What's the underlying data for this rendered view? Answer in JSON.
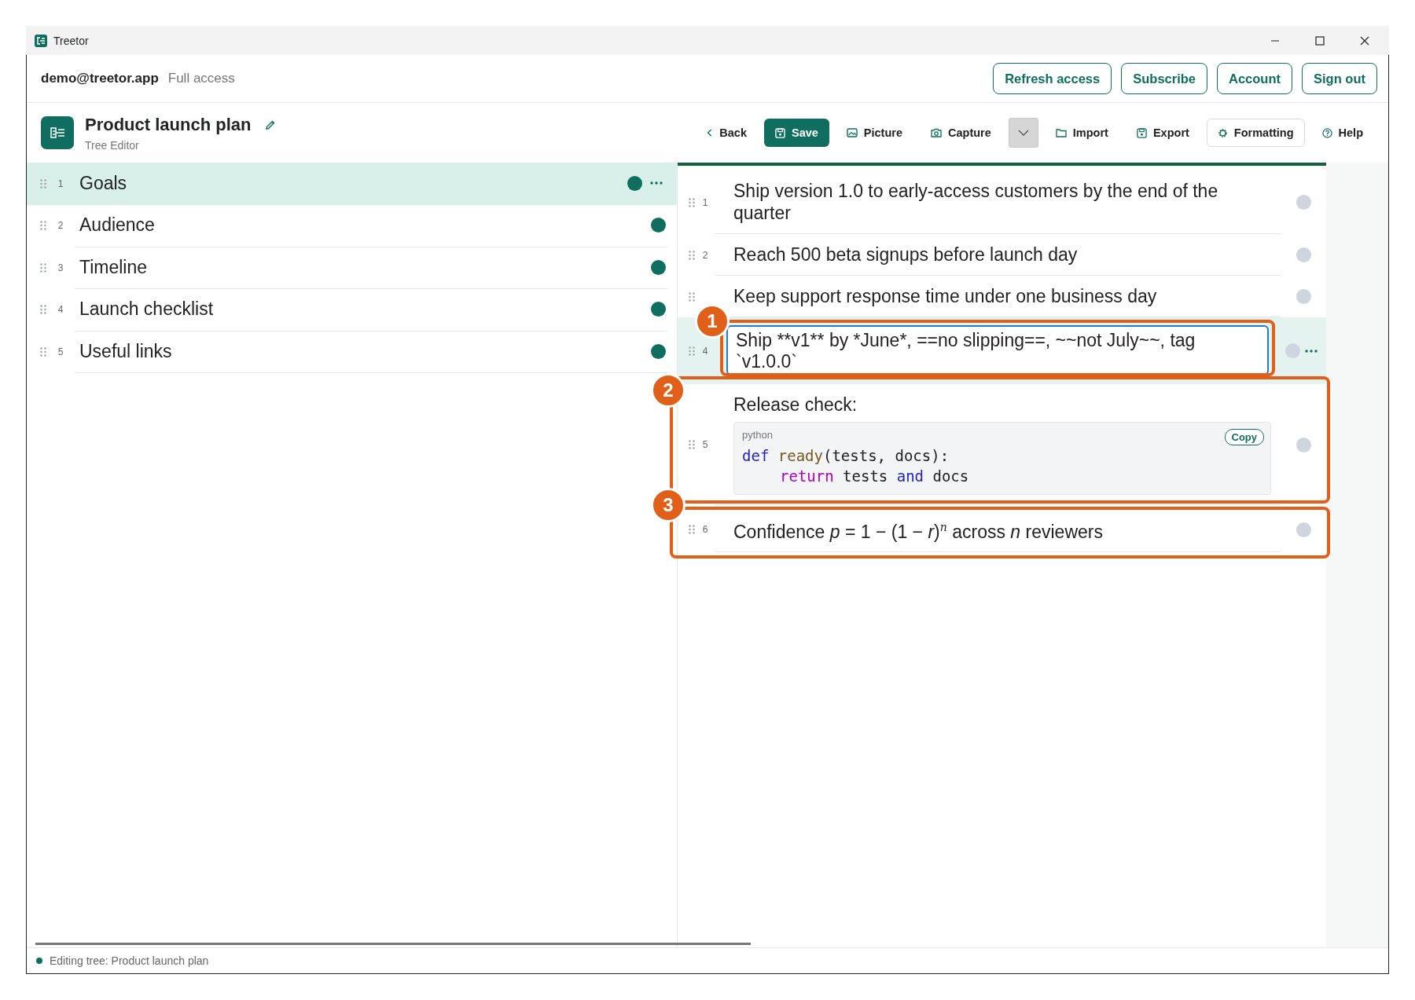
{
  "window": {
    "title": "Treetor"
  },
  "account": {
    "email": "demo@treetor.app",
    "access": "Full access"
  },
  "account_buttons": [
    "Refresh access",
    "Subscribe",
    "Account",
    "Sign out"
  ],
  "document": {
    "title": "Product launch plan",
    "subtitle": "Tree Editor"
  },
  "toolbar": [
    {
      "kind": "back",
      "label": "Back"
    },
    {
      "kind": "save",
      "label": "Save"
    },
    {
      "kind": "picture",
      "label": "Picture"
    },
    {
      "kind": "capture",
      "label": "Capture"
    },
    {
      "kind": "dropdown"
    },
    {
      "kind": "import",
      "label": "Import"
    },
    {
      "kind": "export",
      "label": "Export"
    },
    {
      "kind": "formatting",
      "label": "Formatting"
    },
    {
      "kind": "help",
      "label": "Help"
    }
  ],
  "outline": [
    {
      "number": "1",
      "title": "Goals",
      "selected": true
    },
    {
      "number": "2",
      "title": "Audience",
      "selected": false
    },
    {
      "number": "3",
      "title": "Timeline",
      "selected": false
    },
    {
      "number": "4",
      "title": "Launch checklist",
      "selected": false
    },
    {
      "number": "5",
      "title": "Useful links",
      "selected": false
    }
  ],
  "items": [
    {
      "number": "1",
      "kind": "text",
      "text": "Ship version 1.0 to early-access customers by the end of the quarter",
      "selected": false
    },
    {
      "number": "2",
      "kind": "text",
      "text": "Reach 500 beta signups before launch day",
      "selected": false
    },
    {
      "kind": "text",
      "text": "Keep support response time under one business day",
      "selected": false
    },
    {
      "number": "4",
      "kind": "editing",
      "value": "Ship **v1** by *June*, ==no slipping==, ~~not July~~, tag `v1.0.0`",
      "selected": true
    },
    {
      "number": "5",
      "kind": "code",
      "label": "Release check:",
      "code": {
        "language": "python",
        "copy_label": "Copy",
        "lines": [
          {
            "indented": false,
            "tokens": [
              {
                "kind": "keyword",
                "text": "def"
              },
              {
                "kind": "function",
                "text": " ready"
              },
              {
                "kind": "plain",
                "text": "(tests, docs):"
              }
            ]
          },
          {
            "indented": true,
            "tokens": [
              {
                "kind": "control",
                "text": "return"
              },
              {
                "kind": "plain",
                "text": " tests "
              },
              {
                "kind": "keyword",
                "text": "and"
              },
              {
                "kind": "plain",
                "text": " docs"
              }
            ]
          }
        ]
      },
      "selected": false
    },
    {
      "number": "6",
      "kind": "math",
      "text": "Confidence *p* = 1 − (1 − *r*)$^{n}$ across *n* reviewers",
      "selected": false
    }
  ],
  "annotations": [
    {
      "label": "1"
    },
    {
      "label": "2"
    },
    {
      "label": "3"
    }
  ],
  "status_bar": {
    "text": "Editing tree: Product launch plan"
  }
}
